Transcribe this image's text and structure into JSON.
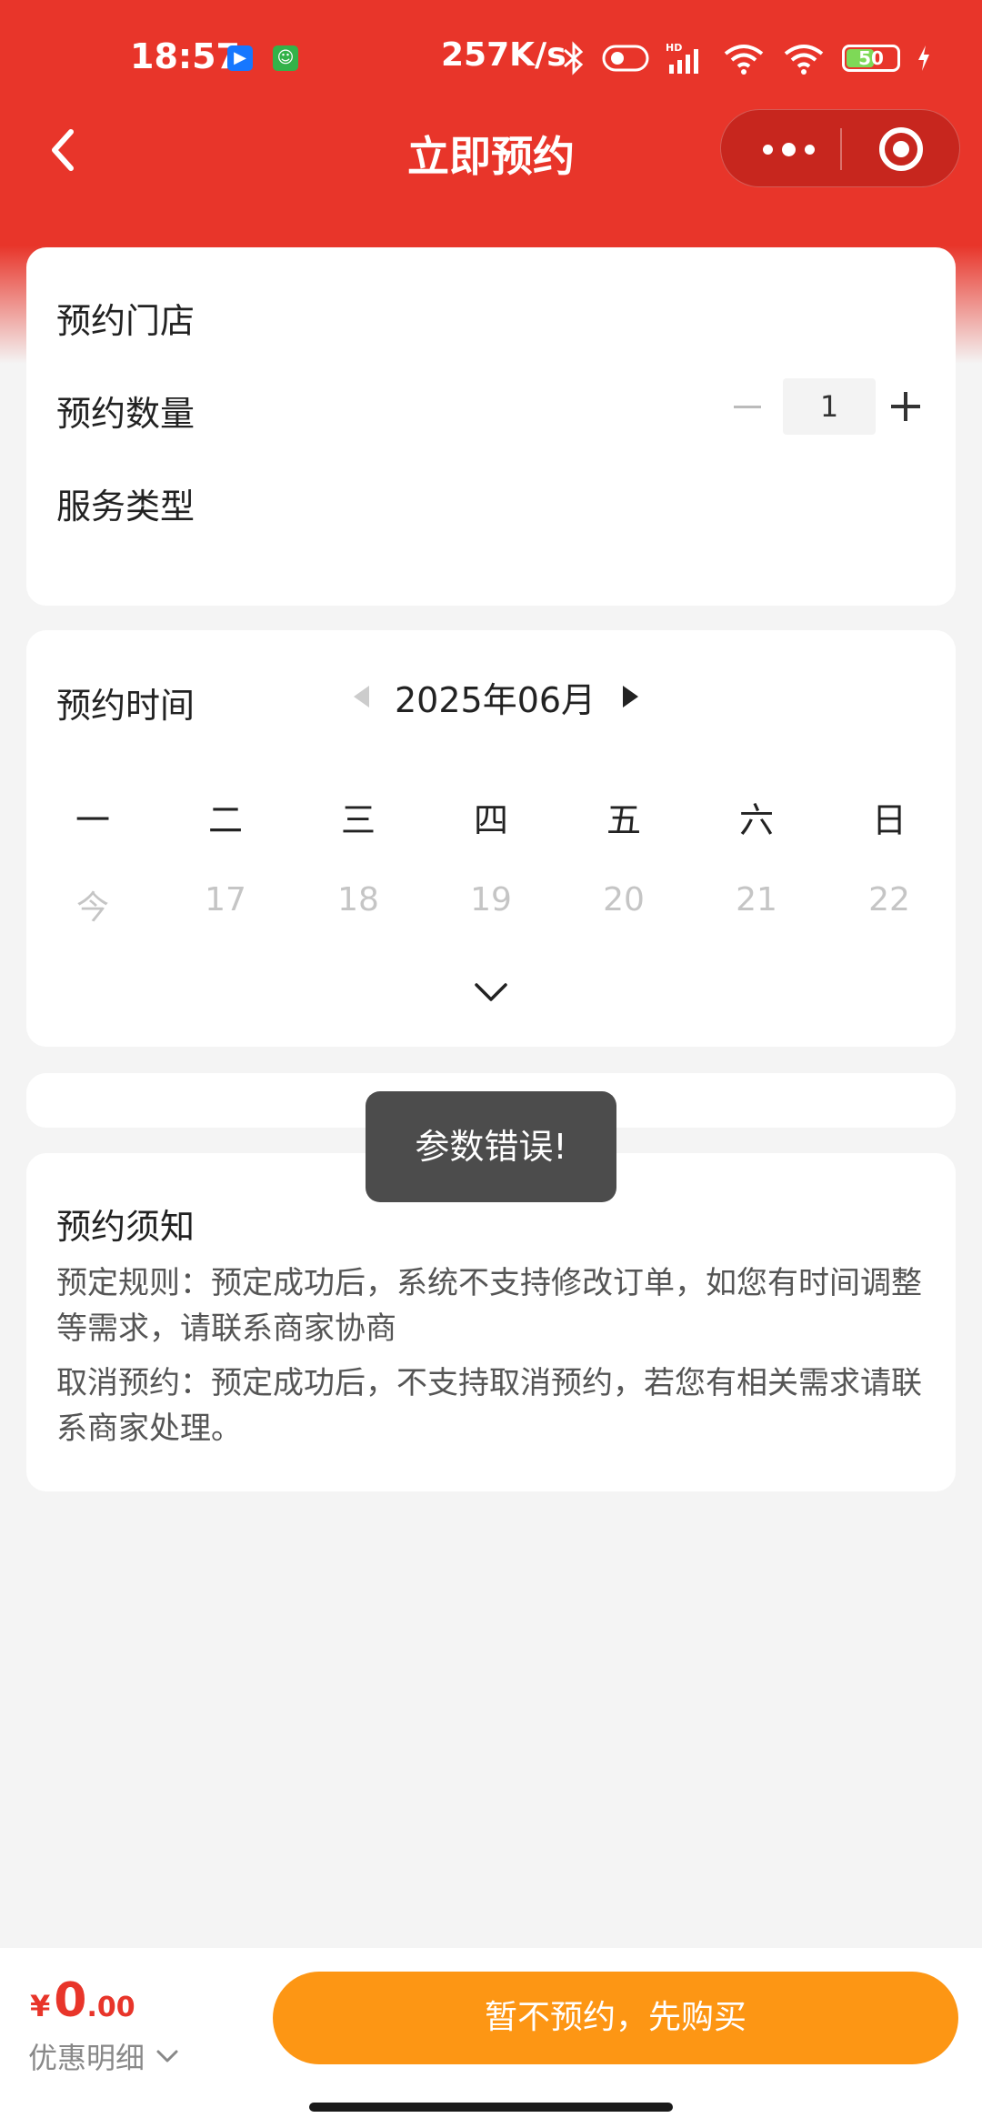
{
  "status_bar": {
    "time": "18:57",
    "net_speed": "257K/s",
    "battery": "50",
    "app_icon_1": "bilibili-like-icon",
    "app_icon_2": "green-cat-icon"
  },
  "nav": {
    "title": "立即预约",
    "back_icon": "chevron-left-icon",
    "more_icon": "more-dots-icon",
    "close_icon": "target-circle-icon"
  },
  "form": {
    "store_label": "预约门店",
    "quantity_label": "预约数量",
    "quantity_value": "1",
    "service_type_label": "服务类型"
  },
  "calendar": {
    "label": "预约时间",
    "month": "2025年06月",
    "weekdays": [
      "一",
      "二",
      "三",
      "四",
      "五",
      "六",
      "日"
    ],
    "dates": [
      "今",
      "17",
      "18",
      "19",
      "20",
      "21",
      "22"
    ]
  },
  "notice": {
    "title": "预约须知",
    "rule": "预定规则：预定成功后，系统不支持修改订单，如您有时间调整等需求，请联系商家协商",
    "cancel": "取消预约：预定成功后，不支持取消预约，若您有相关需求请联系商家处理。"
  },
  "toast": {
    "message": "参数错误!"
  },
  "bottom": {
    "currency": "¥",
    "price_int": "0",
    "price_dec": ".00",
    "discount_label": "优惠明细",
    "buy_button": "暂不预约，先购买"
  },
  "colors": {
    "brand_red": "#e8352a",
    "button_orange": "#fd9614",
    "toast_bg": "#4c4c4c"
  }
}
